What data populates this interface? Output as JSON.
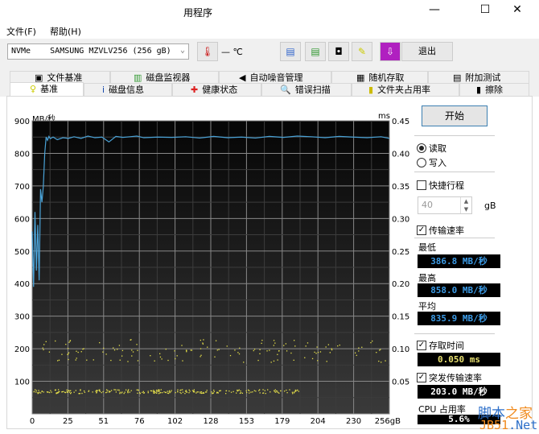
{
  "window": {
    "title": "用程序",
    "minimize": "—",
    "maximize": "☐",
    "close": "✕"
  },
  "menu": [
    "文件(F)",
    "帮助(H)"
  ],
  "toolbar": {
    "drive": "NVMe    SAMSUNG MZVLV256 (256 gB)",
    "temp": "— ℃",
    "exit": "退出"
  },
  "tabs_top": [
    "文件基准",
    "磁盘监视器",
    "自动噪音管理",
    "随机存取",
    "附加测试"
  ],
  "tabs_bottom": [
    "基准",
    "磁盘信息",
    "健康状态",
    "错误扫描",
    "文件夹占用率",
    "擦除"
  ],
  "side": {
    "start": "开始",
    "read": "读取",
    "write": "写入",
    "short_stroke": "快捷行程",
    "stroke_value": "40",
    "stroke_unit": "gB",
    "transfer_rate": "传输速率",
    "min_label": "最低",
    "min_value": "386.8 MB/秒",
    "max_label": "最高",
    "max_value": "858.0 MB/秒",
    "avg_label": "平均",
    "avg_value": "835.9 MB/秒",
    "access_time": "存取时间",
    "access_value": "0.050 ms",
    "burst": "突发传输速率",
    "burst_value": "203.0 MB/秒",
    "cpu_label": "CPU 占用率",
    "cpu_value": "5.6%"
  },
  "watermark": {
    "line1a": "脚本",
    "line1b": "之家",
    "line2a": "JB51",
    "line2b": ".Net"
  },
  "chart_data": {
    "type": "line",
    "ylabel": "MB/秒",
    "y2label": "ms",
    "xunit": "gB",
    "yticks": [
      "900",
      "800",
      "700",
      "600",
      "500",
      "400",
      "300",
      "200",
      "100"
    ],
    "y2ticks": [
      "0.45",
      "0.40",
      "0.35",
      "0.30",
      "0.25",
      "0.20",
      "0.15",
      "0.10",
      "0.05"
    ],
    "xticks": [
      "0",
      "25",
      "51",
      "76",
      "102",
      "128",
      "153",
      "179",
      "204",
      "230",
      "256gB"
    ],
    "ylim": [
      0,
      900
    ],
    "y2lim": [
      0,
      0.45
    ],
    "xlim": [
      0,
      256
    ],
    "series": [
      {
        "name": "传输速率",
        "color": "#4aa3d8",
        "x": [
          0,
          1,
          2,
          3,
          4,
          5,
          6,
          7,
          8,
          9,
          10,
          11,
          12,
          13,
          15,
          18,
          22,
          26,
          30,
          35,
          40,
          45,
          50,
          55,
          60,
          65,
          70,
          75,
          80,
          90,
          100,
          110,
          120,
          130,
          140,
          150,
          160,
          170,
          180,
          190,
          200,
          210,
          220,
          230,
          240,
          250,
          256
        ],
        "y": [
          560,
          390,
          620,
          440,
          580,
          410,
          690,
          650,
          700,
          800,
          850,
          840,
          852,
          845,
          850,
          842,
          848,
          846,
          851,
          846,
          853,
          848,
          850,
          835,
          852,
          849,
          851,
          853,
          848,
          850,
          849,
          851,
          847,
          852,
          848,
          850,
          847,
          852,
          849,
          853,
          851,
          848,
          852,
          850,
          848,
          851,
          846
        ]
      }
    ],
    "access_times": {
      "name": "存取时间",
      "color": "#e6e04a",
      "bands_ms": [
        0.035,
        0.09,
        0.105
      ],
      "x_extent": [
        0,
        256
      ]
    }
  }
}
